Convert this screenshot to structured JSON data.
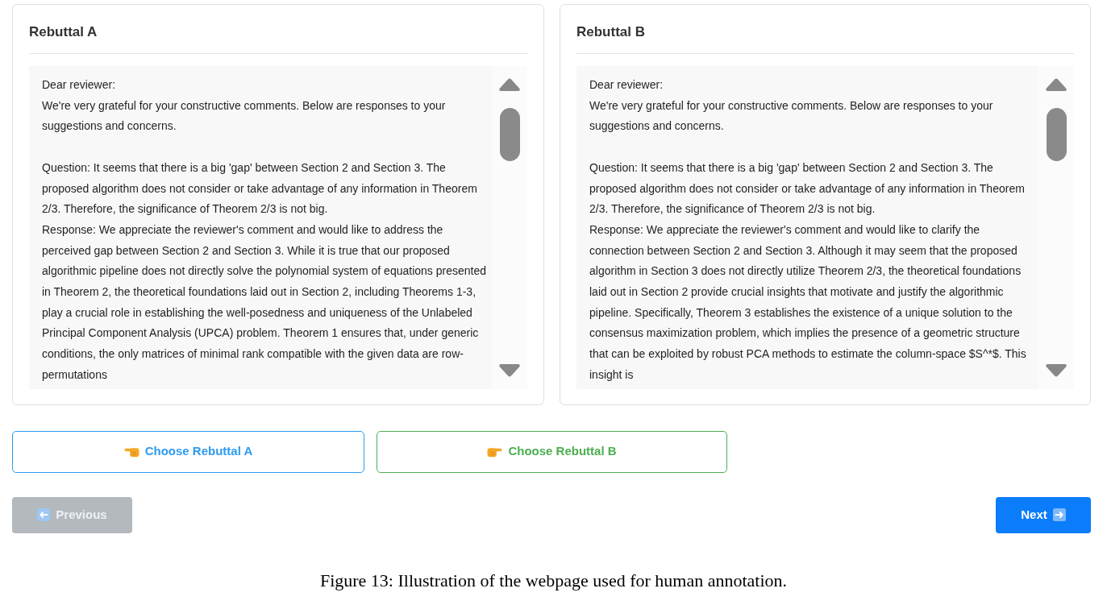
{
  "rebuttals": [
    {
      "title": "Rebuttal A",
      "salutation": "Dear reviewer:",
      "opening": "We're very grateful for your constructive comments. Below are responses to your suggestions and concerns.",
      "question": "Question: It seems that there is a big 'gap' between Section 2 and Section 3. The proposed algorithm does not consider or take advantage of any information in Theorem 2/3. Therefore, the significance of Theorem 2/3 is not big.",
      "response": "Response: We appreciate the reviewer's comment and would like to address the perceived gap between Section 2 and Section 3. While it is true that our proposed algorithmic pipeline does not directly solve the polynomial system of equations presented in Theorem 2, the theoretical foundations laid out in Section 2, including Theorems 1-3, play a crucial role in establishing the well-posedness and uniqueness of the Unlabeled Principal Component Analysis (UPCA) problem. Theorem 1 ensures that, under generic conditions, the only matrices of minimal rank compatible with the given data are row-permutations"
    },
    {
      "title": "Rebuttal B",
      "salutation": "Dear reviewer:",
      "opening": "We're very grateful for your constructive comments. Below are responses to your suggestions and concerns.",
      "question": "Question: It seems that there is a big 'gap' between Section 2 and Section 3. The proposed algorithm does not consider or take advantage of any information in Theorem 2/3. Therefore, the significance of Theorem 2/3 is not big.",
      "response": "Response: We appreciate the reviewer's comment and would like to clarify the connection between Section 2 and Section 3. Although it may seem that the proposed algorithm in Section 3 does not directly utilize Theorem 2/3, the theoretical foundations laid out in Section 2 provide crucial insights that motivate and justify the algorithmic pipeline. Specifically, Theorem 3 establishes the existence of a unique solution to the consensus maximization problem, which implies the presence of a geometric structure that can be exploited by robust PCA methods to estimate the column-space $S^*$. This insight is"
    }
  ],
  "choices": [
    {
      "label": "Choose Rebuttal A",
      "kind": "left",
      "color": "#2d9bf0"
    },
    {
      "label": "Choose Rebuttal B",
      "kind": "right",
      "color": "#4cae50"
    }
  ],
  "nav_buttons": [
    {
      "label": "Previous",
      "kind": "back",
      "disabled": true
    },
    {
      "label": "Next",
      "kind": "forward",
      "disabled": false
    }
  ],
  "caption": "Figure 13: Illustration of the webpage used for human annotation."
}
